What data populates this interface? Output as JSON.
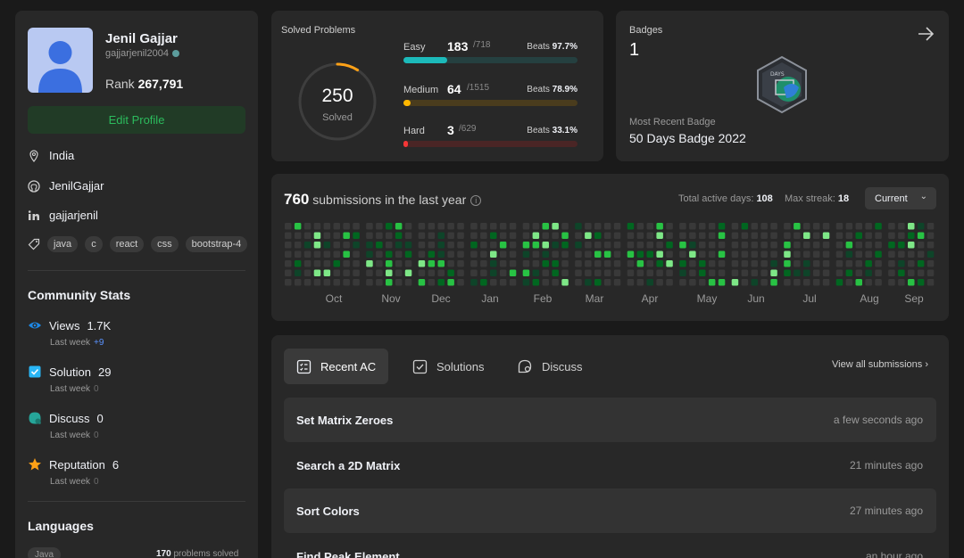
{
  "profile": {
    "name": "Jenil Gajjar",
    "handle": "gajjarjenil2004",
    "rank_label": "Rank",
    "rank_value": "267,791",
    "edit_label": "Edit Profile",
    "location": "India",
    "github": "JenilGajjar",
    "linkedin": "gajjarjenil",
    "skills": [
      "java",
      "c",
      "react",
      "css",
      "bootstrap-4"
    ]
  },
  "community": {
    "title": "Community Stats",
    "stats": [
      {
        "label": "Views",
        "value": "1.7K",
        "sub": "Last week",
        "delta": "+9",
        "icon": "eye-icon",
        "color": "#1e88e5"
      },
      {
        "label": "Solution",
        "value": "29",
        "sub": "Last week",
        "delta": "0",
        "icon": "check-square-icon",
        "color": "#29b6f6"
      },
      {
        "label": "Discuss",
        "value": "0",
        "sub": "Last week",
        "delta": "0",
        "icon": "chat-icon",
        "color": "#26a69a"
      },
      {
        "label": "Reputation",
        "value": "6",
        "sub": "Last week",
        "delta": "0",
        "icon": "star-icon",
        "color": "#ffa116"
      }
    ]
  },
  "languages": {
    "title": "Languages",
    "first": "Java",
    "count": "170",
    "count_suffix": "problems solved"
  },
  "solved": {
    "title": "Solved Problems",
    "count": "250",
    "label": "Solved",
    "progress_fraction": 0.09,
    "difficulties": [
      {
        "label": "Easy",
        "solved": "183",
        "total": "/718",
        "beats_label": "Beats",
        "beats": "97.7%",
        "fraction": 0.25,
        "color": "#1cbaba",
        "track": "#254040"
      },
      {
        "label": "Medium",
        "solved": "64",
        "total": "/1515",
        "beats_label": "Beats",
        "beats": "78.9%",
        "fraction": 0.04,
        "color": "#ffb700",
        "track": "#4a3c1d"
      },
      {
        "label": "Hard",
        "solved": "3",
        "total": "/629",
        "beats_label": "Beats",
        "beats": "33.1%",
        "fraction": 0.005,
        "color": "#f63737",
        "track": "#4a2525"
      }
    ]
  },
  "badges": {
    "title": "Badges",
    "count": "1",
    "badge_text": "DAYS",
    "recent_label": "Most Recent Badge",
    "recent_name": "50 Days Badge 2022"
  },
  "heatmap": {
    "count": "760",
    "title_suffix": "submissions in the last year",
    "active_label": "Total active days:",
    "active_value": "108",
    "streak_label": "Max streak:",
    "streak_value": "18",
    "year": "Current",
    "months": [
      "Oct",
      "Nov",
      "Dec",
      "Jan",
      "Feb",
      "Mar",
      "Apr",
      "May",
      "Jun",
      "Jul",
      "Aug",
      "Sep"
    ],
    "colors": [
      "#393939",
      "#0e4429",
      "#016620",
      "#28c244",
      "#7ee787"
    ]
  },
  "recent": {
    "tabs": [
      {
        "label": "Recent AC",
        "icon": "list-icon"
      },
      {
        "label": "Solutions",
        "icon": "check-box-icon"
      },
      {
        "label": "Discuss",
        "icon": "discuss-icon"
      }
    ],
    "view_all": "View all submissions",
    "rows": [
      {
        "title": "Set Matrix Zeroes",
        "time": "a few seconds ago"
      },
      {
        "title": "Search a 2D Matrix",
        "time": "21 minutes ago"
      },
      {
        "title": "Sort Colors",
        "time": "27 minutes ago"
      },
      {
        "title": "Find Peak Element",
        "time": "an hour ago"
      }
    ]
  }
}
